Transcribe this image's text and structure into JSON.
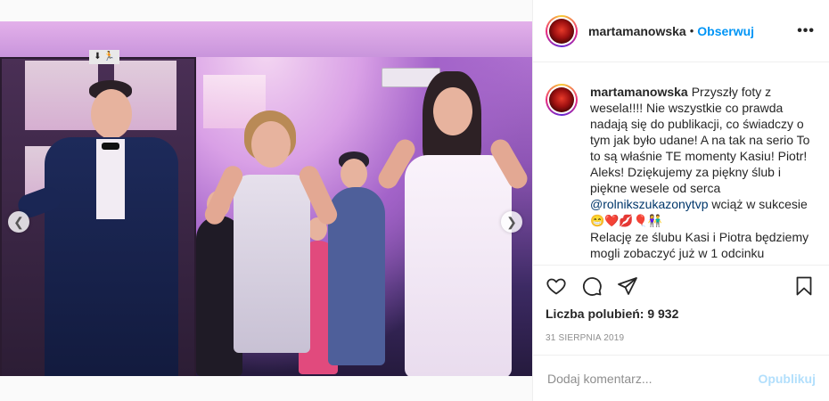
{
  "post": {
    "photo_exit_sign": "⬇ 🏃",
    "carousel": {
      "total": 6,
      "active_index": 4
    }
  },
  "header": {
    "username": "martamanowska",
    "separator": "•",
    "follow_label": "Obserwuj",
    "more_icon": "more-dots-icon",
    "more_label": "•••"
  },
  "caption": {
    "username": "martamanowska",
    "text_part1": "Przyszły foty z wesela!!!! Nie wszystkie co prawda nadają się do publikacji, co świadczy o tym jak było udane! A na tak na serio To to są właśnie TE momenty Kasiu! Piotr! Aleks! Dziękujemy za piękny ślub i piękne wesele od serca",
    "mention": "@rolnikszukazonytvp",
    "text_part2": "wciąż w sukcesie",
    "emojis": "😁❤️💋🎈👫",
    "text_part3": "Relację ze ślubu Kasi i Piotra będziemy mogli zobaczyć już w 1 odcinku"
  },
  "actions": {
    "like_icon": "heart-icon",
    "comment_icon": "comment-icon",
    "share_icon": "share-icon",
    "save_icon": "bookmark-icon"
  },
  "likes": {
    "text": "Liczba polubień: 9 932"
  },
  "date": {
    "text": "31 SIERPNIA 2019"
  },
  "comment": {
    "placeholder": "Dodaj komentarz...",
    "publish_label": "Opublikuj"
  },
  "colors": {
    "accent": "#0095f6",
    "publish_disabled": "#b2dffc",
    "secondary_text": "#8e8e8e"
  }
}
